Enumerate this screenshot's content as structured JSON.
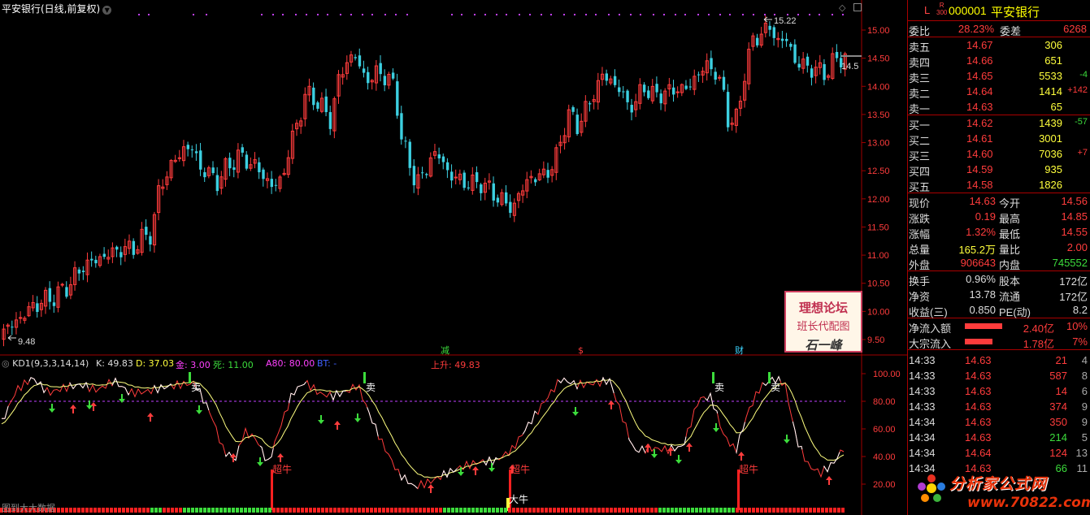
{
  "chart": {
    "title": "平安银行(日线,前复权)",
    "price_labels": [
      "15.00",
      "14.50",
      "14.00",
      "13.50",
      "13.00",
      "12.50",
      "12.00",
      "11.50",
      "11.00",
      "10.50",
      "10.00",
      "9.50"
    ],
    "high_marker": "15.22",
    "low_marker": "9.48",
    "last_price_marker": "14.5",
    "event_markers": [
      "减",
      "$",
      "财"
    ],
    "badge": {
      "line1": "理想论坛",
      "line2": "班长代配图",
      "line3": "石一峰"
    },
    "bottom_left": "图到大大数据",
    "colors": {
      "up": "#ff3c3c",
      "down": "#3ccfe0",
      "bg": "#000000",
      "grid": "#a00000"
    }
  },
  "indicator": {
    "name": "KD1(9,3,3,14,14)",
    "k": "K: 49.83",
    "d": "D: 37.03",
    "jin": "金: 3.00",
    "si": "死: 11.00",
    "a80": "A80: 80.00",
    "bt": "BT: -",
    "shangsheng": "上升: 49.83",
    "axis_labels": [
      "100.00",
      "80.00",
      "60.00",
      "40.00",
      "20.00"
    ],
    "sell_label": "卖",
    "super_bull_label": "超牛",
    "big_bull_label": "大牛"
  },
  "quote": {
    "L": "L",
    "R300": "R\n300",
    "code": "000001",
    "name": "平安银行",
    "weibi": {
      "label": "委比",
      "value": "28.23%"
    },
    "weicha": {
      "label": "委差",
      "value": "6268"
    },
    "asks": [
      {
        "label": "卖五",
        "price": "14.67",
        "vol": "306",
        "chg": ""
      },
      {
        "label": "卖四",
        "price": "14.66",
        "vol": "651",
        "chg": ""
      },
      {
        "label": "卖三",
        "price": "14.65",
        "vol": "5533",
        "chg": "-4"
      },
      {
        "label": "卖二",
        "price": "14.64",
        "vol": "1414",
        "chg": "+142"
      },
      {
        "label": "卖一",
        "price": "14.63",
        "vol": "65",
        "chg": ""
      }
    ],
    "bids": [
      {
        "label": "买一",
        "price": "14.62",
        "vol": "1439",
        "chg": "-57"
      },
      {
        "label": "买二",
        "price": "14.61",
        "vol": "3001",
        "chg": ""
      },
      {
        "label": "买三",
        "price": "14.60",
        "vol": "7036",
        "chg": "+7"
      },
      {
        "label": "买四",
        "price": "14.59",
        "vol": "935",
        "chg": ""
      },
      {
        "label": "买五",
        "price": "14.58",
        "vol": "1826",
        "chg": ""
      }
    ],
    "stats": [
      {
        "l1": "现价",
        "v1": "14.63",
        "l2": "今开",
        "v2": "14.56"
      },
      {
        "l1": "涨跌",
        "v1": "0.19",
        "l2": "最高",
        "v2": "14.85"
      },
      {
        "l1": "涨幅",
        "v1": "1.32%",
        "l2": "最低",
        "v2": "14.55"
      },
      {
        "l1": "总量",
        "v1": "165.2万",
        "l2": "量比",
        "v2": "2.00"
      },
      {
        "l1": "外盘",
        "v1": "906643",
        "l2": "内盘",
        "v2": "745552"
      }
    ],
    "stats2": [
      {
        "l1": "换手",
        "v1": "0.96%",
        "l2": "股本",
        "v2": "172亿"
      },
      {
        "l1": "净资",
        "v1": "13.78",
        "l2": "流通",
        "v2": "172亿"
      },
      {
        "l1": "收益(三)",
        "v1": "0.850",
        "l2": "PE(动)",
        "v2": "8.2"
      }
    ],
    "flows": [
      {
        "label": "净流入额",
        "value": "2.40亿",
        "pct": "10%"
      },
      {
        "label": "大宗流入",
        "value": "1.78亿",
        "pct": "7%"
      }
    ],
    "ticks": [
      {
        "time": "14:33",
        "price": "14.63",
        "vol": "21",
        "n": "4",
        "color": "red"
      },
      {
        "time": "14:33",
        "price": "14.63",
        "vol": "587",
        "n": "8",
        "color": "red"
      },
      {
        "time": "14:33",
        "price": "14.63",
        "vol": "14",
        "n": "6",
        "color": "red"
      },
      {
        "time": "14:33",
        "price": "14.63",
        "vol": "374",
        "n": "9",
        "color": "red"
      },
      {
        "time": "14:34",
        "price": "14.63",
        "vol": "350",
        "n": "9",
        "color": "red"
      },
      {
        "time": "14:34",
        "price": "14.63",
        "vol": "214",
        "n": "5",
        "color": "grn"
      },
      {
        "time": "14:34",
        "price": "14.64",
        "vol": "124",
        "n": "13",
        "color": "red"
      },
      {
        "time": "14:34",
        "price": "14.63",
        "vol": "66",
        "n": "11",
        "color": "grn"
      }
    ]
  },
  "watermark": {
    "text1": "分析家公式网",
    "text2": "www.70822.com"
  }
}
